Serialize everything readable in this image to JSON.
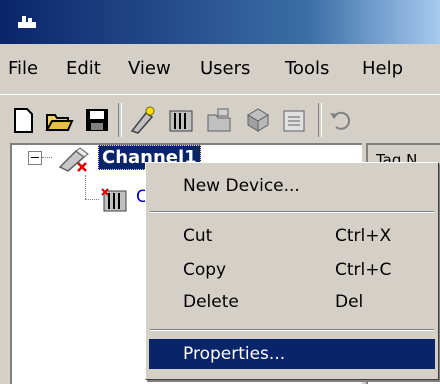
{
  "menubar": {
    "items": [
      "File",
      "Edit",
      "View",
      "Users",
      "Tools",
      "Help"
    ]
  },
  "toolbar": {
    "icons": [
      "new-icon",
      "open-icon",
      "save-icon",
      "new-channel-icon",
      "new-device-icon",
      "new-tag-group-icon",
      "new-tag-icon",
      "properties-icon",
      "undo-icon"
    ]
  },
  "tree": {
    "channel_label": "Channel1",
    "device_label": "C"
  },
  "right_pane": {
    "column_header": "Tag N"
  },
  "context_menu": {
    "new_device": "New Device...",
    "cut": "Cut",
    "cut_shortcut": "Ctrl+X",
    "copy": "Copy",
    "copy_shortcut": "Ctrl+C",
    "delete": "Delete",
    "delete_shortcut": "Del",
    "properties": "Properties..."
  }
}
